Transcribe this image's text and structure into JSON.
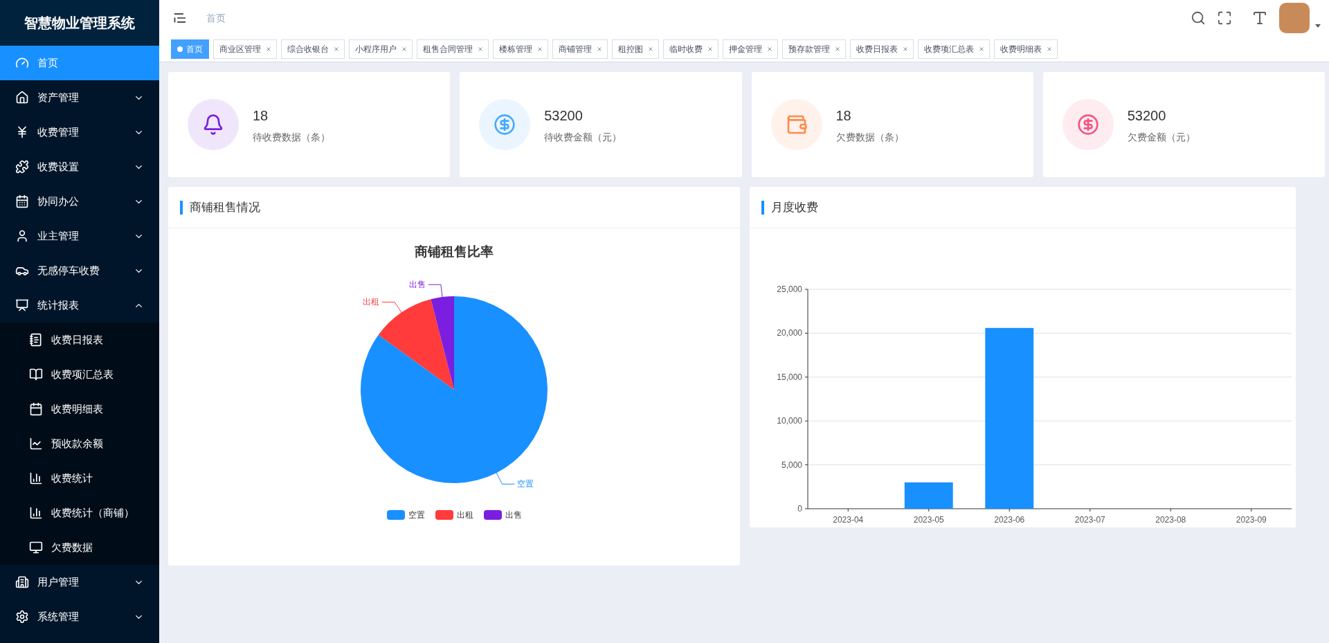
{
  "sidebar": {
    "title": "智慧物业管理系统",
    "items": [
      {
        "label": "首页",
        "kind": "link",
        "selected": true
      },
      {
        "label": "资产管理",
        "kind": "group",
        "selected": false,
        "expanded": false
      },
      {
        "label": "收费管理",
        "kind": "group",
        "selected": false,
        "expanded": false
      },
      {
        "label": "收费设置",
        "kind": "group",
        "selected": false,
        "expanded": false
      },
      {
        "label": "协同办公",
        "kind": "group",
        "selected": false,
        "expanded": false
      },
      {
        "label": "业主管理",
        "kind": "group",
        "selected": false,
        "expanded": false
      },
      {
        "label": "无感停车收费",
        "kind": "group",
        "selected": false,
        "expanded": false
      },
      {
        "label": "统计报表",
        "kind": "group",
        "selected": false,
        "expanded": true,
        "children": [
          {
            "label": "收费日报表",
            "selected": false
          },
          {
            "label": "收费项汇总表",
            "selected": false
          },
          {
            "label": "收费明细表",
            "selected": false
          },
          {
            "label": "预收款余额",
            "selected": false
          },
          {
            "label": "收费统计",
            "selected": false
          },
          {
            "label": "收费统计（商铺）",
            "selected": false
          },
          {
            "label": "欠费数据",
            "selected": false
          }
        ]
      },
      {
        "label": "用户管理",
        "kind": "group",
        "selected": false,
        "expanded": false
      },
      {
        "label": "系统管理",
        "kind": "group",
        "selected": false,
        "expanded": false
      }
    ]
  },
  "header": {
    "breadcrumb": "首页"
  },
  "tabs": [
    {
      "label": "首页",
      "selected": true,
      "closable": false
    },
    {
      "label": "商业区管理",
      "selected": false,
      "closable": true
    },
    {
      "label": "综合收银台",
      "selected": false,
      "closable": true
    },
    {
      "label": "小程序用户",
      "selected": false,
      "closable": true
    },
    {
      "label": "租售合同管理",
      "selected": false,
      "closable": true
    },
    {
      "label": "楼栋管理",
      "selected": false,
      "closable": true
    },
    {
      "label": "商铺管理",
      "selected": false,
      "closable": true
    },
    {
      "label": "租控图",
      "selected": false,
      "closable": true
    },
    {
      "label": "临时收费",
      "selected": false,
      "closable": true
    },
    {
      "label": "押金管理",
      "selected": false,
      "closable": true
    },
    {
      "label": "预存款管理",
      "selected": false,
      "closable": true
    },
    {
      "label": "收费日报表",
      "selected": false,
      "closable": true
    },
    {
      "label": "收费项汇总表",
      "selected": false,
      "closable": true
    },
    {
      "label": "收费明细表",
      "selected": false,
      "closable": true
    }
  ],
  "stats": [
    {
      "value": "18",
      "label": "待收费数据（条）",
      "color": "#7a1fe0"
    },
    {
      "value": "53200",
      "label": "待收费金额（元）",
      "color": "#45a8ff"
    },
    {
      "value": "18",
      "label": "欠费数据（条）",
      "color": "#ff8a4c"
    },
    {
      "value": "53200",
      "label": "欠费金额（元）",
      "color": "#f55282"
    }
  ],
  "panels": [
    {
      "title": "商铺租售情况",
      "chart_data": {
        "type": "pie",
        "title": "商铺租售比率",
        "categories": [
          "空置",
          "出租",
          "出售"
        ],
        "values": [
          85,
          11,
          4
        ],
        "colors": [
          "#1890ff",
          "#ff3b3b",
          "#7a1fe0"
        ],
        "legend": "bottom"
      }
    },
    {
      "title": "月度收费",
      "chart_data": {
        "type": "bar",
        "categories": [
          "2023-04",
          "2023-05",
          "2023-06",
          "2023-07",
          "2023-08",
          "2023-09"
        ],
        "series": [
          {
            "color": "#1890ff",
            "values": [
              0,
              3000,
              20600,
              0,
              0,
              0
            ]
          }
        ],
        "grid": true,
        "ylim": [
          0,
          25000
        ],
        "yticks": [
          {
            "value": 0,
            "label": "0"
          },
          {
            "value": 5000,
            "label": "5,000"
          },
          {
            "value": 10000,
            "label": "10,000"
          },
          {
            "value": 15000,
            "label": "15,000"
          },
          {
            "value": 20000,
            "label": "20,000"
          },
          {
            "value": 25000,
            "label": "25,000"
          }
        ]
      }
    }
  ]
}
